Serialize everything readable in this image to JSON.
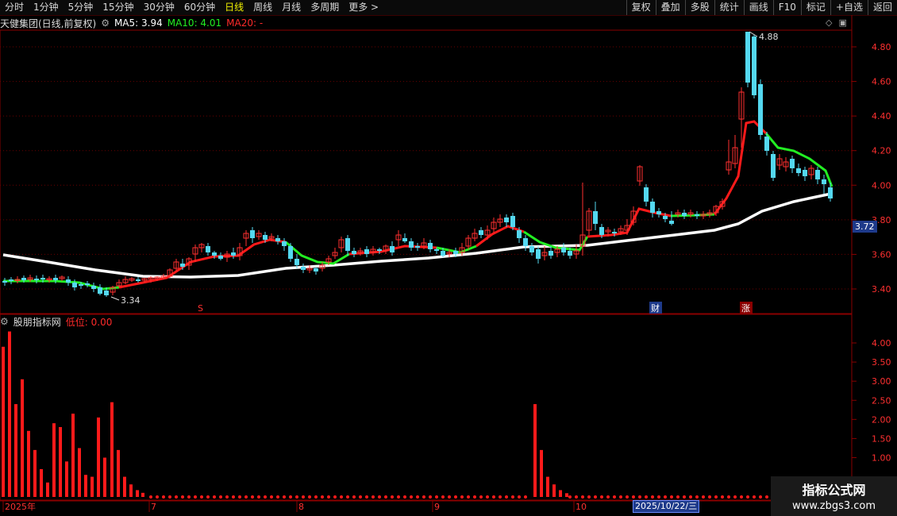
{
  "toolbar": {
    "left": [
      "分时",
      "1分钟",
      "5分钟",
      "15分钟",
      "30分钟",
      "60分钟",
      "日线",
      "周线",
      "月线",
      "多周期",
      "更多 >"
    ],
    "active": "日线",
    "right": [
      "复权",
      "叠加",
      "多股",
      "统计",
      "画线",
      "F10",
      "标记",
      "+自选",
      "返回"
    ]
  },
  "title": {
    "stock": "天健集团(日线,前复权)",
    "ma5": "MA5: 3.94",
    "ma10": "MA10: 4.01",
    "ma20": "MA20: -"
  },
  "indicator": {
    "name": "股朋指标网",
    "value": "低位: 0.00"
  },
  "price_axis": [
    "4.80",
    "4.60",
    "4.40",
    "4.20",
    "4.00",
    "3.80",
    "3.60",
    "3.40"
  ],
  "ind_axis": [
    "4.00",
    "3.50",
    "3.00",
    "2.50",
    "2.00",
    "1.50",
    "1.00"
  ],
  "current_price": "3.72",
  "high_label": "4.88",
  "low_label": "3.34",
  "markers": {
    "s": "S",
    "cai": "财",
    "zhang": "涨"
  },
  "date_labels": [
    "2025年",
    "7",
    "8",
    "9",
    "10"
  ],
  "cursor_date": "2025/10/22/三",
  "watermark": {
    "line1": "指标公式网",
    "line2": "www.zbgs3.com"
  },
  "colors": {
    "up": "#ff3030",
    "down": "#54d8f0",
    "ma_up": "#ff1a1a",
    "ma_down": "#22ee22",
    "long_ma": "#ffffff",
    "bars": "#ff1a1a"
  },
  "chart_data": {
    "type": "candlestick",
    "series": [
      {
        "name": "股朋指标网",
        "type": "bar",
        "values": [
          3.9,
          4.3,
          2.4,
          3.05,
          1.7,
          1.2,
          0.7,
          0.35,
          1.9,
          0.9,
          0.5,
          2.15,
          1.0,
          0.35,
          2.05,
          1.25,
          2.45,
          1.2,
          0.5,
          0.3,
          0.15,
          0.08,
          0.05,
          2.4,
          1.2,
          0.5,
          0.3,
          0.15,
          0.07
        ]
      }
    ]
  }
}
